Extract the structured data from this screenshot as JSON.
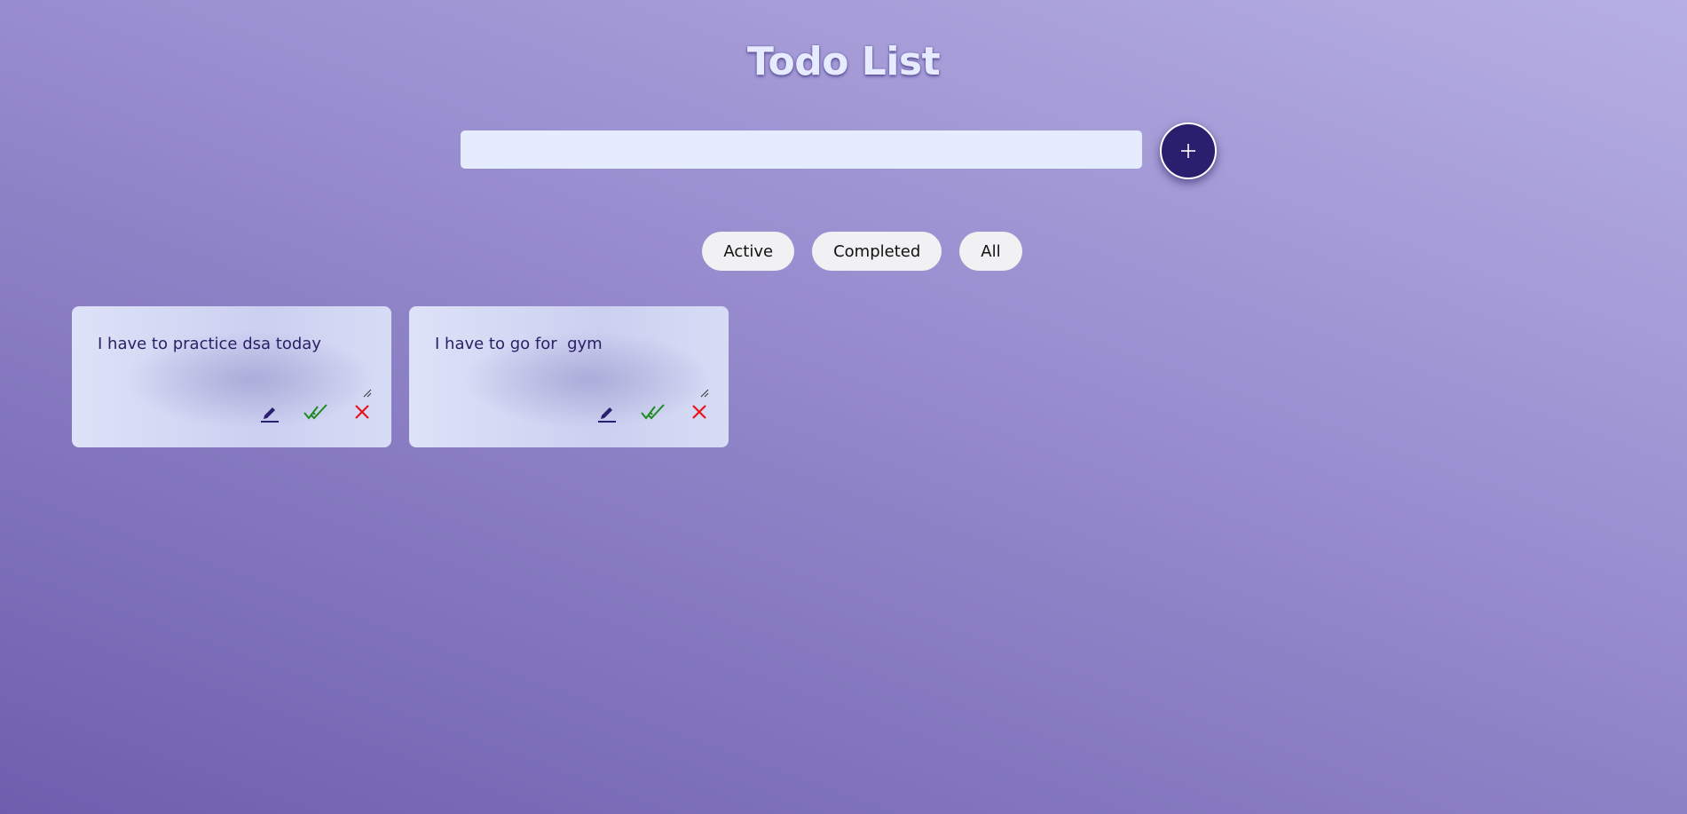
{
  "header": {
    "title": "Todo List"
  },
  "input": {
    "value": "",
    "placeholder": ""
  },
  "add_button": {
    "icon": "plus-icon",
    "background": "#2a1e6e"
  },
  "filters": [
    {
      "label": "Active"
    },
    {
      "label": "Completed"
    },
    {
      "label": "All"
    }
  ],
  "todos": [
    {
      "text": "I have to practice dsa today"
    },
    {
      "text": "I have to go for  gym"
    }
  ],
  "actions": {
    "edit_icon": "pencil-icon",
    "complete_icon": "double-check-icon",
    "delete_icon": "close-icon"
  },
  "colors": {
    "edit": "#2a1e6e",
    "complete": "#1f8a1f",
    "delete": "#e8141b",
    "text": "#2a2066"
  }
}
